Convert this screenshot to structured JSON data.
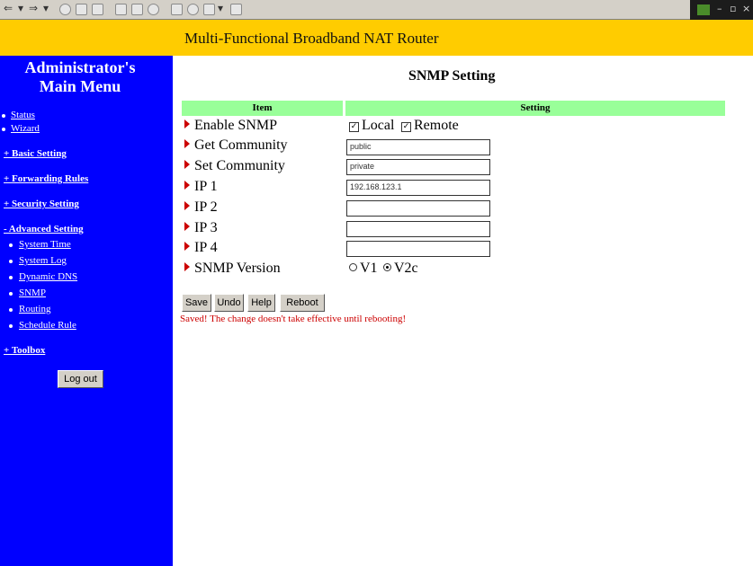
{
  "banner": {
    "title": "Multi-Functional Broadband NAT Router"
  },
  "sidebar": {
    "heading_line1": "Administrator's",
    "heading_line2": "Main Menu",
    "top_links": [
      "Status",
      "Wizard"
    ],
    "sections": [
      "+ Basic Setting",
      "+ Forwarding Rules",
      "+ Security Setting",
      "- Advanced Setting"
    ],
    "advanced_items": [
      "System Time",
      "System Log",
      "Dynamic DNS",
      "SNMP",
      "Routing",
      "Schedule Rule"
    ],
    "toolbox": "+ Toolbox",
    "logout": "Log out"
  },
  "main": {
    "title": "SNMP Setting",
    "col_item": "Item",
    "col_setting": "Setting",
    "rows": [
      {
        "label": "Enable SNMP"
      },
      {
        "label": "Get Community",
        "value": "public"
      },
      {
        "label": "Set Community",
        "value": "private"
      },
      {
        "label": "IP 1",
        "value": "192.168.123.1"
      },
      {
        "label": "IP 2",
        "value": ""
      },
      {
        "label": "IP 3",
        "value": ""
      },
      {
        "label": "IP 4",
        "value": ""
      },
      {
        "label": "SNMP Version"
      }
    ],
    "enable_local": "Local",
    "enable_remote": "Remote",
    "local_checked": true,
    "remote_checked": true,
    "version_v1": "V1",
    "version_v2c": "V2c",
    "version_selected": "V2c",
    "buttons": {
      "save": "Save",
      "undo": "Undo",
      "help": "Help",
      "reboot": "Reboot"
    },
    "message": "Saved! The change doesn't take effective until rebooting!"
  },
  "colors": {
    "banner": "#ffcc00",
    "sidebar": "#0000ff",
    "header_row": "#99ff99",
    "message": "#cc0000"
  }
}
